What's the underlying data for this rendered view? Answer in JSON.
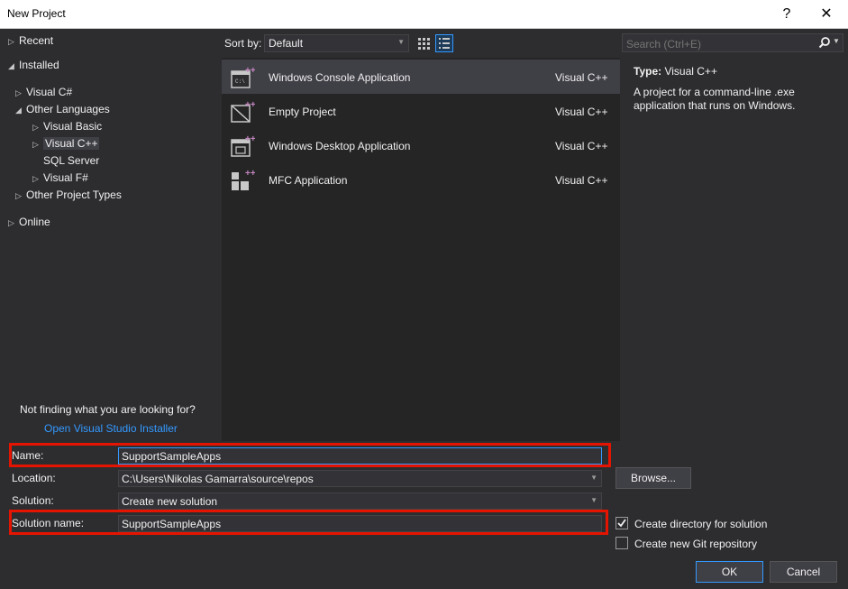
{
  "window": {
    "title": "New Project",
    "help_label": "?",
    "close_label": "✕"
  },
  "tree": {
    "recent": "Recent",
    "installed": "Installed",
    "visual_csharp": "Visual C#",
    "other_languages": "Other Languages",
    "visual_basic": "Visual Basic",
    "visual_cpp": "Visual C++",
    "sql_server": "SQL Server",
    "visual_fsharp": "Visual F#",
    "other_project_types": "Other Project Types",
    "online": "Online"
  },
  "help": {
    "not_finding": "Not finding what you are looking for?",
    "installer_link": "Open Visual Studio Installer"
  },
  "sort": {
    "label": "Sort by:",
    "value": "Default"
  },
  "search": {
    "placeholder": "Search (Ctrl+E)"
  },
  "templates": [
    {
      "name": "Windows Console Application",
      "lang": "Visual C++",
      "icon": "console-app-icon"
    },
    {
      "name": "Empty Project",
      "lang": "Visual C++",
      "icon": "empty-project-icon"
    },
    {
      "name": "Windows Desktop Application",
      "lang": "Visual C++",
      "icon": "desktop-app-icon"
    },
    {
      "name": "MFC Application",
      "lang": "Visual C++",
      "icon": "mfc-app-icon"
    }
  ],
  "details": {
    "type_label": "Type:",
    "type_value": "Visual C++",
    "description": "A project for a command-line .exe application that runs on Windows."
  },
  "form": {
    "name_label": "Name:",
    "name_value": "SupportSampleApps",
    "location_label": "Location:",
    "location_value": "C:\\Users\\Nikolas Gamarra\\source\\repos",
    "solution_label": "Solution:",
    "solution_value": "Create new solution",
    "solution_name_label": "Solution name:",
    "solution_name_value": "SupportSampleApps",
    "browse_label": "Browse...",
    "create_dir_label": "Create directory for solution",
    "create_dir_checked": true,
    "create_git_label": "Create new Git repository",
    "create_git_checked": false,
    "ok_label": "OK",
    "cancel_label": "Cancel"
  },
  "colors": {
    "accent": "#3399ff",
    "highlight_box": "#e51400",
    "cpp_plus": "#c586c0"
  }
}
